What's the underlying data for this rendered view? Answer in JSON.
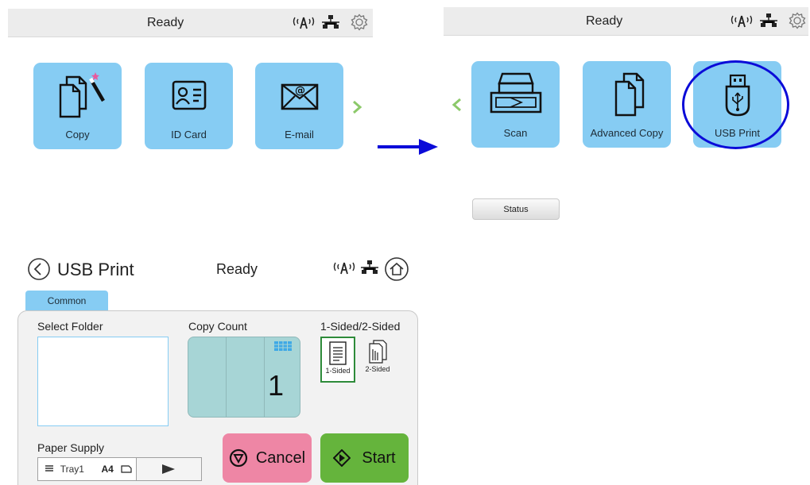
{
  "home_screen_1": {
    "status": "Ready",
    "tiles": [
      {
        "label": "Copy",
        "icon": "copy-magic-icon"
      },
      {
        "label": "ID Card",
        "icon": "id-card-icon"
      },
      {
        "label": "E-mail",
        "icon": "email-envelope-icon"
      }
    ],
    "next_icon": "chevron-right-icon"
  },
  "home_screen_2": {
    "status": "Ready",
    "tiles": [
      {
        "label": "Scan",
        "icon": "scanner-icon"
      },
      {
        "label": "Advanced Copy",
        "icon": "copy-icon"
      },
      {
        "label": "USB Print",
        "icon": "usb-drive-icon"
      }
    ],
    "prev_icon": "chevron-left-icon",
    "status_button": "Status",
    "highlighted_tile": "USB Print"
  },
  "usb_print_screen": {
    "title": "USB Print",
    "status": "Ready",
    "tab": "Common",
    "select_folder_label": "Select Folder",
    "copy_count_label": "Copy Count",
    "copy_count_value": "1",
    "sided_label": "1-Sided/2-Sided",
    "sided_options": [
      {
        "label": "1-Sided",
        "selected": true
      },
      {
        "label": "2-Sided",
        "selected": false
      }
    ],
    "paper_supply_label": "Paper Supply",
    "paper_tray": "Tray1",
    "paper_size": "A4",
    "cancel_label": "Cancel",
    "start_label": "Start"
  },
  "colors": {
    "tile": "#86ccf3",
    "accent_green": "#6db33f",
    "chevron_green": "#8cc96a",
    "cancel_pink": "#ee86a5",
    "start_green": "#65b43c",
    "arrow_blue": "#0b0bd8",
    "count_teal": "#a7d5d6"
  }
}
